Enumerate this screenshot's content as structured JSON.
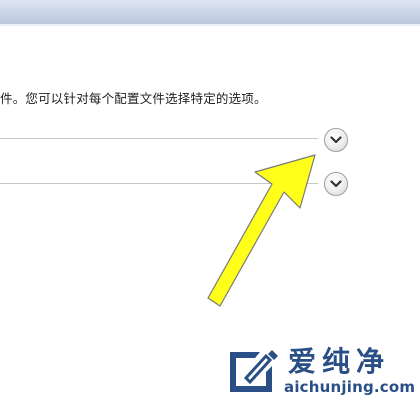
{
  "window": {
    "description": "件。您可以针对每个配置文件选择特定的选项。"
  },
  "sections": [
    {
      "expand_icon": "chevron-down-icon"
    },
    {
      "expand_icon": "chevron-down-icon"
    }
  ],
  "annotation": {
    "arrow_color": "#ffff1a",
    "arrow_outline": "#7a7a7a"
  },
  "watermark": {
    "title": "爱纯净",
    "url": "aichunjing.com",
    "color": "#2a4f86"
  }
}
